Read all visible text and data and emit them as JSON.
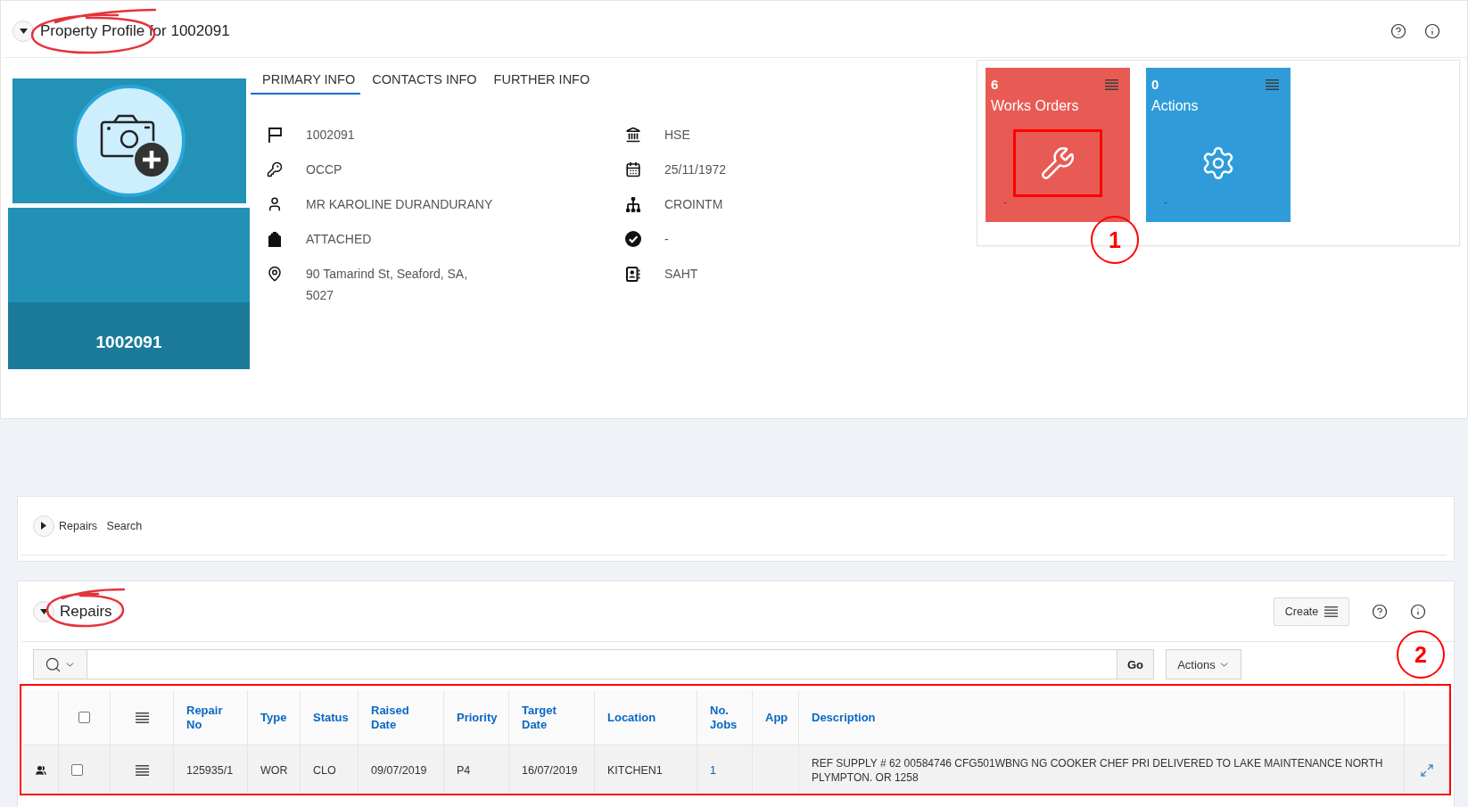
{
  "header": {
    "title": "Property Profile for 1002091",
    "expanded": true,
    "circled": true
  },
  "photo": {
    "caption": "1002091"
  },
  "tabs": [
    {
      "label": "PRIMARY INFO",
      "selected": true
    },
    {
      "label": "CONTACTS INFO",
      "selected": false
    },
    {
      "label": "FURTHER INFO",
      "selected": false
    }
  ],
  "details": [
    "1002091",
    "HSE",
    "OCCP",
    "25/11/1972",
    "MR KAROLINE DURANDURANY",
    "CROINTM",
    "ATTACHED",
    "-",
    "90 Tamarind St, Seaford, SA, 5027",
    "SAHT"
  ],
  "tiles": [
    {
      "count": "6",
      "title": "Works Orders",
      "footer": "-",
      "color": "#e85b55",
      "highlighted": true,
      "callout": "1"
    },
    {
      "count": "0",
      "title": "Actions",
      "footer": "-",
      "color": "#2f9cd9",
      "highlighted": false
    }
  ],
  "search_region": {
    "title": "Repairs Search",
    "expanded": false
  },
  "repairs": {
    "title": "Repairs",
    "expanded": true,
    "circled": true,
    "callout": "2",
    "create_button": "Create",
    "go_button": "Go",
    "actions_button": "Actions",
    "table": {
      "highlighted": true,
      "select_all_checked": false,
      "columns": [
        "Repair No",
        "Type",
        "Status",
        "Raised Date",
        "Priority",
        "Target Date",
        "Location",
        "No. Jobs",
        "App",
        "Description"
      ],
      "rows": [
        {
          "checked": false,
          "repair_no": "125935/1",
          "type": "WOR",
          "status": "CLO",
          "raised_date": "09/07/2019",
          "priority": "P4",
          "target_date": "16/07/2019",
          "location": "KITCHEN1",
          "no_jobs": "1",
          "description": "REF SUPPLY # 62 00584746 CFG501WBNG NG COOKER CHEF PRI DELIVERED TO LAKE MAINTENANCE NORTH PLYMPTON. OR 1258"
        }
      ]
    }
  }
}
